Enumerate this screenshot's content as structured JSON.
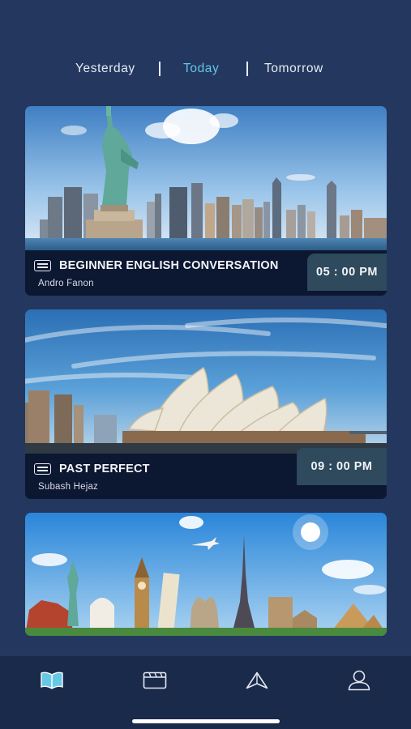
{
  "day_tabs": {
    "yesterday": "Yesterday",
    "today": "Today",
    "tomorrow": "Tomorrow",
    "active": "Today"
  },
  "classes": [
    {
      "title": "BEGINNER ENGLISH CONVERSATION",
      "teacher": "Andro Fanon",
      "time": "05 : 00 PM",
      "image": "new-york-skyline-statue-of-liberty"
    },
    {
      "title": "PAST PERFECT",
      "teacher": "Subash Hejaz",
      "time": "09 : 00 PM",
      "image": "sydney-opera-house"
    },
    {
      "image": "world-landmarks-collage"
    }
  ],
  "bottom_nav": [
    {
      "icon": "book-icon",
      "active": true
    },
    {
      "icon": "video-icon",
      "active": false
    },
    {
      "icon": "send-icon",
      "active": false
    },
    {
      "icon": "user-icon",
      "active": false
    }
  ],
  "colors": {
    "background": "#24375e",
    "active_tab": "#62c6e6",
    "time_badge": "#2e4a5c",
    "nav_bar": "#1a2a4b"
  }
}
